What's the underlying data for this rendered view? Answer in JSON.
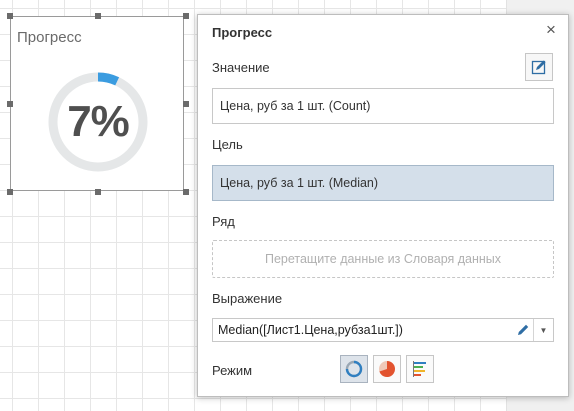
{
  "widget": {
    "title": "Прогресс",
    "value_text": "7%",
    "progress": 0.07,
    "colors": {
      "track": "#e5e7e8",
      "fill": "#3b9ce0"
    }
  },
  "panel": {
    "title": "Прогресс",
    "close_icon": "close-icon",
    "value": {
      "label": "Значение",
      "field": "Цена, руб за 1 шт. (Count)"
    },
    "target": {
      "label": "Цель",
      "field": "Цена, руб за 1 шт. (Median)"
    },
    "series": {
      "label": "Ряд",
      "placeholder": "Перетащите данные из Словаря данных"
    },
    "expression": {
      "label": "Выражение",
      "value": "Median([Лист1.Цена,рубза1шт.])"
    },
    "mode": {
      "label": "Режим",
      "options": [
        {
          "icon": "circle-progress-icon",
          "active": true
        },
        {
          "icon": "pie-progress-icon",
          "active": false
        },
        {
          "icon": "bar-progress-icon",
          "active": false
        }
      ]
    }
  }
}
